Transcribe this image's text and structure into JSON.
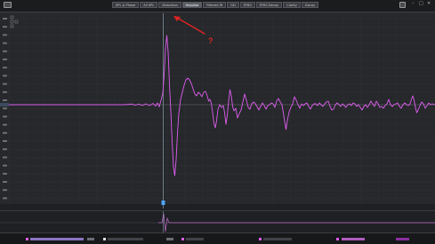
{
  "toolbar": {
    "tabs": [
      {
        "label": "SPL & Phase",
        "active": false
      },
      {
        "label": "All SPL",
        "active": false
      },
      {
        "label": "Distortion",
        "active": false
      },
      {
        "label": "Impulse",
        "active": true
      },
      {
        "label": "Filtered IR",
        "active": false
      },
      {
        "label": "GD",
        "active": false
      },
      {
        "label": "RT60",
        "active": false
      },
      {
        "label": "RT60 Decay",
        "active": false
      },
      {
        "label": "Clarity",
        "active": false
      },
      {
        "label": "Decay",
        "active": false
      }
    ]
  },
  "annotation": {
    "text": "?",
    "color": "#e02424"
  },
  "colors": {
    "trace": "#e05cf0",
    "cursor": "#9fb4c8",
    "marker": "#4fa3ff"
  }
}
